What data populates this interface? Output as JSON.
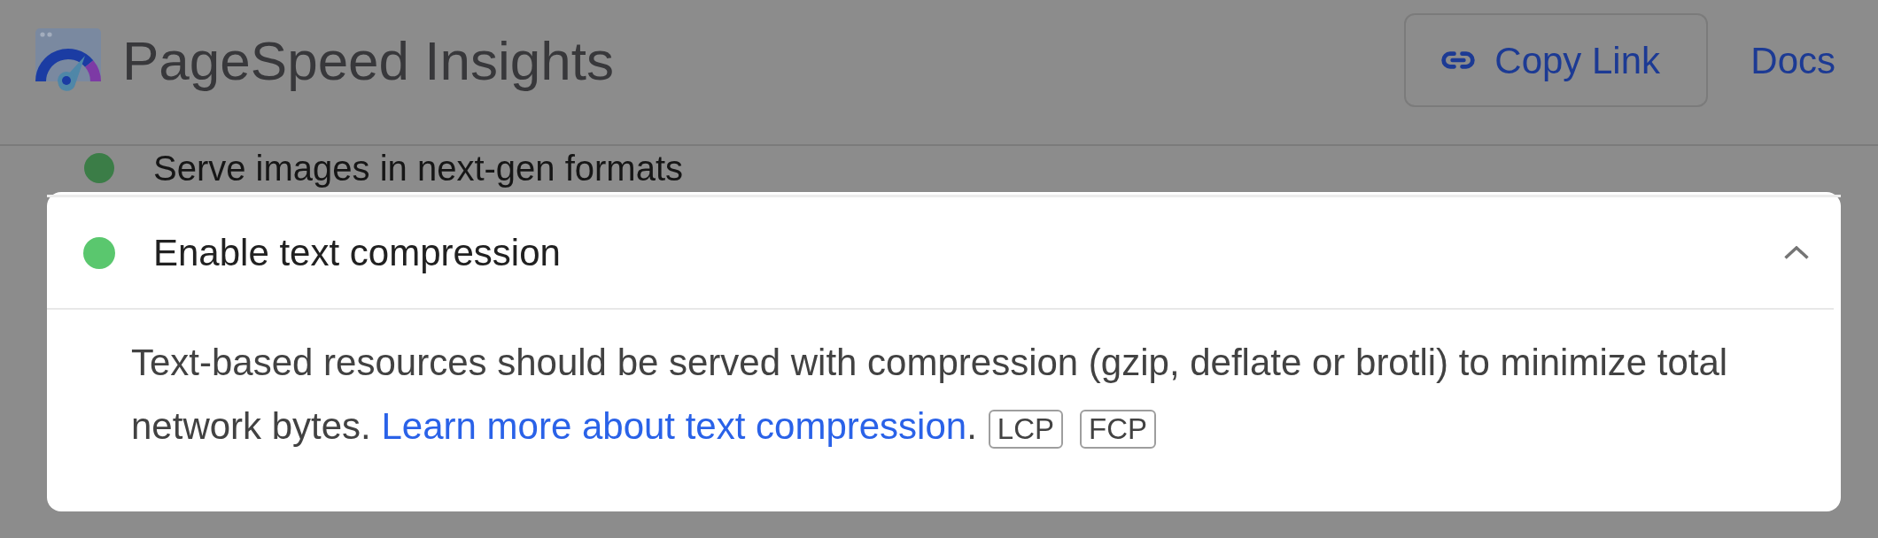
{
  "header": {
    "title": "PageSpeed Insights",
    "copy_link": {
      "label": "Copy Link"
    },
    "docs": {
      "label": "Docs"
    }
  },
  "audits": [
    {
      "title": "Serve images in next-gen formats",
      "color": "#3b7d47",
      "focused": false
    },
    {
      "title": "Enable text compression",
      "color": "#5ac76e",
      "focused": true,
      "expanded": true,
      "description": {
        "text": "Text-based resources should be served with compression (gzip, deflate or brotli) to minimize total network bytes.",
        "link": "Learn more about text compression",
        "after_link": ".",
        "tags": [
          "LCP",
          "FCP"
        ]
      }
    }
  ]
}
